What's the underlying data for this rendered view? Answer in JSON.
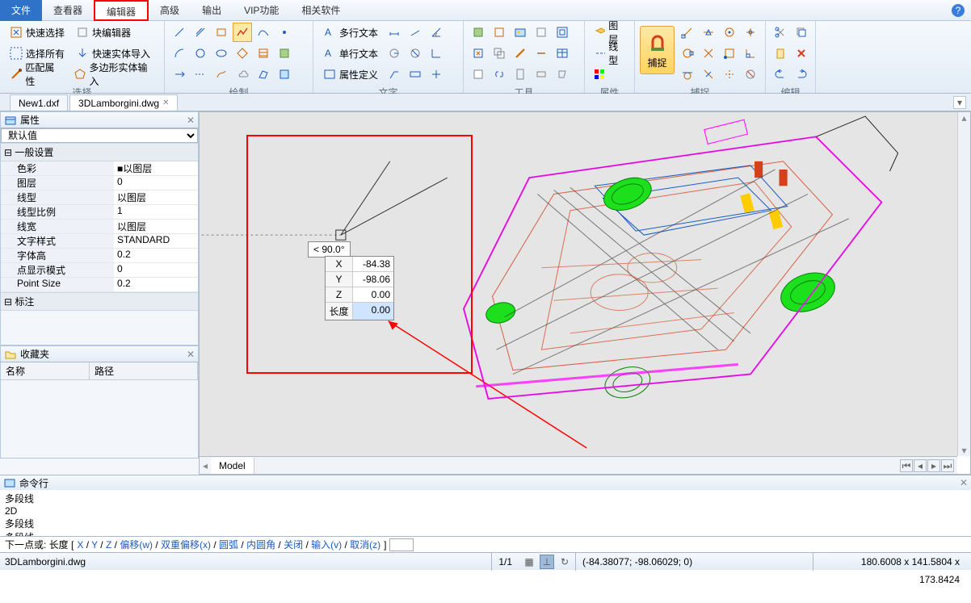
{
  "menu": {
    "file": "文件",
    "viewer": "查看器",
    "editor": "编辑器",
    "advanced": "高级",
    "output": "输出",
    "vip": "VIP功能",
    "related": "相关软件"
  },
  "ribbon": {
    "select": {
      "label": "选择",
      "quick": "快速选择",
      "block_editor": "块编辑器",
      "select_all": "选择所有",
      "quick_import": "快速实体导入",
      "match_props": "匹配属性",
      "polygon_import": "多边形实体输入"
    },
    "draw": {
      "label": "绘制"
    },
    "text": {
      "label": "文字",
      "mtext": "多行文本",
      "stext": "单行文本",
      "attr_def": "属性定义"
    },
    "tools": {
      "label": "工具"
    },
    "props": {
      "label": "属性",
      "layer": "图层",
      "ltype": "线型"
    },
    "snap": {
      "label": "捕捉",
      "btn": "捕捉"
    },
    "edit": {
      "label": "编辑"
    }
  },
  "tabs": {
    "t1": "New1.dxf",
    "t2": "3DLamborgini.dwg"
  },
  "properties": {
    "title": "属性",
    "default": "默认值",
    "general": "一般设置",
    "dimension": "标注",
    "rows": [
      {
        "k": "色彩",
        "v": "■以图层"
      },
      {
        "k": "图层",
        "v": "0"
      },
      {
        "k": "线型",
        "v": "以图层"
      },
      {
        "k": "线型比例",
        "v": "1"
      },
      {
        "k": "线宽",
        "v": "以图层"
      },
      {
        "k": "文字样式",
        "v": "STANDARD"
      },
      {
        "k": "字体高",
        "v": "0.2"
      },
      {
        "k": "点显示模式",
        "v": "0"
      },
      {
        "k": "Point Size",
        "v": "0.2"
      }
    ],
    "fav": {
      "title": "收藏夹",
      "col1": "名称",
      "col2": "路径"
    }
  },
  "canvas": {
    "model_tab": "Model",
    "angle": "< 90.0°",
    "coords": [
      [
        "X",
        "-84.38"
      ],
      [
        "Y",
        "-98.06"
      ],
      [
        "Z",
        "0.00"
      ],
      [
        "长度",
        "0.00"
      ]
    ]
  },
  "cmd": {
    "title": "命令行",
    "lines": [
      "多段线",
      "2D",
      "多段线",
      "多段线"
    ],
    "prompt_prefix": "下一点或: 长度 [",
    "opts": [
      "X",
      "Y",
      "Z",
      "偏移(w)",
      "双重偏移(x)",
      "圆弧",
      "内圆角",
      "关闭",
      "输入(v)",
      "取消(z)"
    ],
    "prompt_suffix": "]"
  },
  "status": {
    "file": "3DLamborgini.dwg",
    "page": "1/1",
    "coords": "(-84.38077; -98.06029; 0)",
    "dims": "180.6008 x 141.5804 x 173.8424"
  }
}
